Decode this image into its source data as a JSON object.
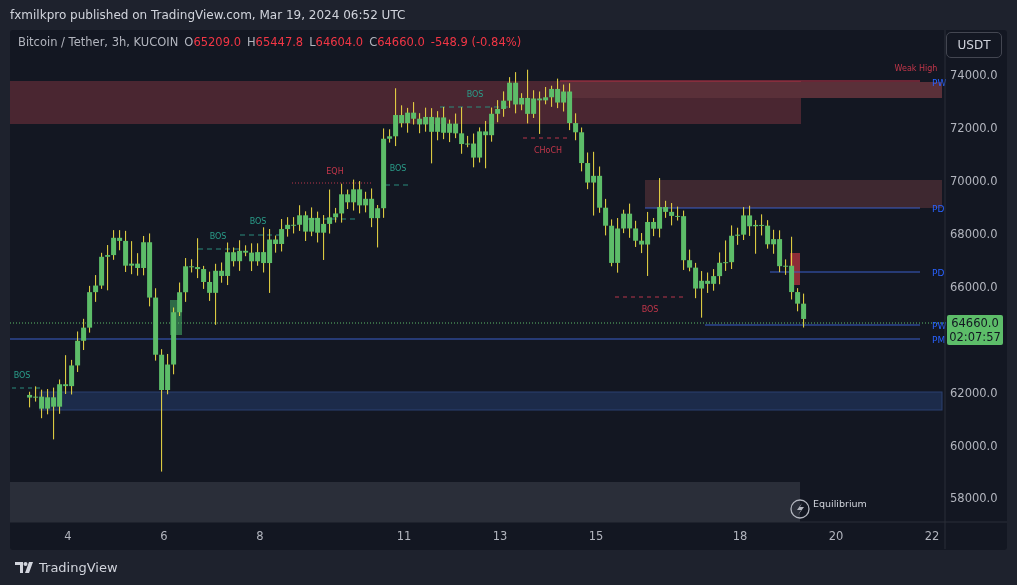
{
  "header": {
    "attribution": "fxmilkpro published on TradingView.com, Mar 19, 2024 06:52 UTC"
  },
  "legend": {
    "symbol": "Bitcoin / Tether, 3h, KUCOIN",
    "values": [
      {
        "key": "O",
        "value": "65209.0"
      },
      {
        "key": "H",
        "value": "65447.8"
      },
      {
        "key": "L",
        "value": "64604.0"
      },
      {
        "key": "C",
        "value": "64660.0"
      }
    ],
    "change": "-548.9 (-0.84%)"
  },
  "currency_button": "USDT",
  "price_axis": [
    "74000.0",
    "72000.0",
    "70000.0",
    "68000.0",
    "66000.0",
    "62000.0",
    "60000.0",
    "58000.0"
  ],
  "time_axis": [
    "4",
    "6",
    "8",
    "11",
    "13",
    "15",
    "18",
    "20",
    "22"
  ],
  "last_price": {
    "price": "64660.0",
    "countdown": "02:07:57"
  },
  "annotations": [
    {
      "text": "BOS",
      "kind": "bullish"
    },
    {
      "text": "BOS",
      "kind": "bullish"
    },
    {
      "text": "BOS",
      "kind": "bullish"
    },
    {
      "text": "EQH",
      "kind": "bearish"
    },
    {
      "text": "BOS",
      "kind": "bullish"
    },
    {
      "text": "BOS",
      "kind": "bullish"
    },
    {
      "text": "CHoCH",
      "kind": "bearish"
    },
    {
      "text": "BOS",
      "kind": "bearish"
    },
    {
      "text": "Weak High",
      "kind": "bearish"
    }
  ],
  "level_labels": [
    "PW",
    "PD",
    "PD",
    "PW",
    "PM"
  ],
  "indicator": {
    "label": "Equilibrium"
  },
  "footer": {
    "brand": "TradingView"
  }
}
